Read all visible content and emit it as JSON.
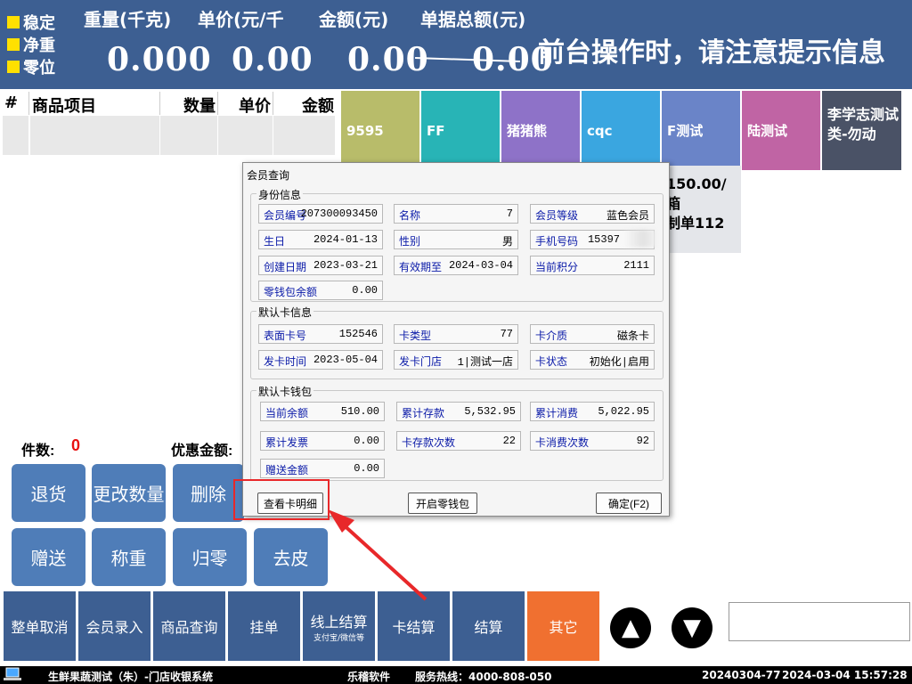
{
  "top": {
    "status": [
      "稳定",
      "净重",
      "零位"
    ],
    "headers": {
      "weight": "重量(千克)",
      "unit_price": "单价(元/千",
      "amount": "金额(元)",
      "total": "单据总额(元)"
    },
    "values": {
      "weight": "0.000",
      "unit_price": "0.00",
      "amount": "0.00",
      "total": "0.00"
    },
    "notice": "前台操作时，请注意提示信息"
  },
  "table": {
    "headers": [
      "#",
      "商品项目",
      "数量",
      "单价",
      "金额"
    ]
  },
  "categories": [
    {
      "label": "9595",
      "color": "#b8bc6a"
    },
    {
      "label": "FF",
      "color": "#28b4b6"
    },
    {
      "label": "猪猪熊",
      "color": "#8e72c8"
    },
    {
      "label": "cqc",
      "color": "#3aa6e0"
    },
    {
      "label": "F测试",
      "color": "#6a84c8"
    },
    {
      "label": "陆测试",
      "color": "#c064a4"
    },
    {
      "label": "李学志测试类-勿动",
      "color": "#4a5266"
    }
  ],
  "product_info": {
    "line1": "150.00/箱",
    "line2": "制单112"
  },
  "summary": {
    "count_label": "件数:",
    "count_value": "0",
    "discount_label": "优惠金额:"
  },
  "action_buttons": [
    "退货",
    "更改数量",
    "删除",
    "赠送",
    "称重",
    "归零",
    "去皮"
  ],
  "bottom_buttons": [
    {
      "label": "整单取消",
      "sub": ""
    },
    {
      "label": "会员录入",
      "sub": ""
    },
    {
      "label": "商品查询",
      "sub": ""
    },
    {
      "label": "挂单",
      "sub": ""
    },
    {
      "label": "线上结算",
      "sub": "支付宝/微信等"
    },
    {
      "label": "卡结算",
      "sub": ""
    },
    {
      "label": "结算",
      "sub": ""
    },
    {
      "label": "其它",
      "sub": ""
    }
  ],
  "status_bar": {
    "app": "生鲜果蔬测试（朱）-门店收银系统",
    "vendor": "乐稽软件",
    "hotline": "服务热线：4000-808-050",
    "doc": "20240304-77",
    "datetime": "2024-03-04 15:57:28"
  },
  "dialog": {
    "title": "会员查询",
    "identity": {
      "title": "身份信息",
      "fields": [
        {
          "k": "会员编号",
          "v": "207300093450"
        },
        {
          "k": "名称",
          "v": "7"
        },
        {
          "k": "会员等级",
          "v": "蓝色会员"
        },
        {
          "k": "生日",
          "v": "2024-01-13"
        },
        {
          "k": "性别",
          "v": "男"
        },
        {
          "k": "手机号码",
          "v": "15397"
        },
        {
          "k": "创建日期",
          "v": "2023-03-21"
        },
        {
          "k": "有效期至",
          "v": "2024-03-04"
        },
        {
          "k": "当前积分",
          "v": "2111"
        },
        {
          "k": "零钱包余额",
          "v": "0.00"
        }
      ]
    },
    "card": {
      "title": "默认卡信息",
      "fields": [
        {
          "k": "表面卡号",
          "v": "152546"
        },
        {
          "k": "卡类型",
          "v": "77"
        },
        {
          "k": "卡介质",
          "v": "磁条卡"
        },
        {
          "k": "发卡时间",
          "v": "2023-05-04"
        },
        {
          "k": "发卡门店",
          "v": "1|测试一店"
        },
        {
          "k": "卡状态",
          "v": "初始化|启用"
        }
      ]
    },
    "wallet": {
      "title": "默认卡钱包",
      "fields": [
        {
          "k": "当前余额",
          "v": "510.00"
        },
        {
          "k": "累计存款",
          "v": "5,532.95"
        },
        {
          "k": "累计消费",
          "v": "5,022.95"
        },
        {
          "k": "累计发票",
          "v": "0.00"
        },
        {
          "k": "卡存款次数",
          "v": "22"
        },
        {
          "k": "卡消费次数",
          "v": "92"
        },
        {
          "k": "赠送金额",
          "v": "0.00"
        }
      ]
    },
    "buttons": {
      "detail": "查看卡明细",
      "open_wallet": "开启零钱包",
      "ok": "确定(F2)"
    }
  },
  "colors": {
    "header_bg": "#3d5f92",
    "button_blue": "#4f7db8",
    "other_button": "#f07030",
    "highlight_red": "#e8282a"
  }
}
